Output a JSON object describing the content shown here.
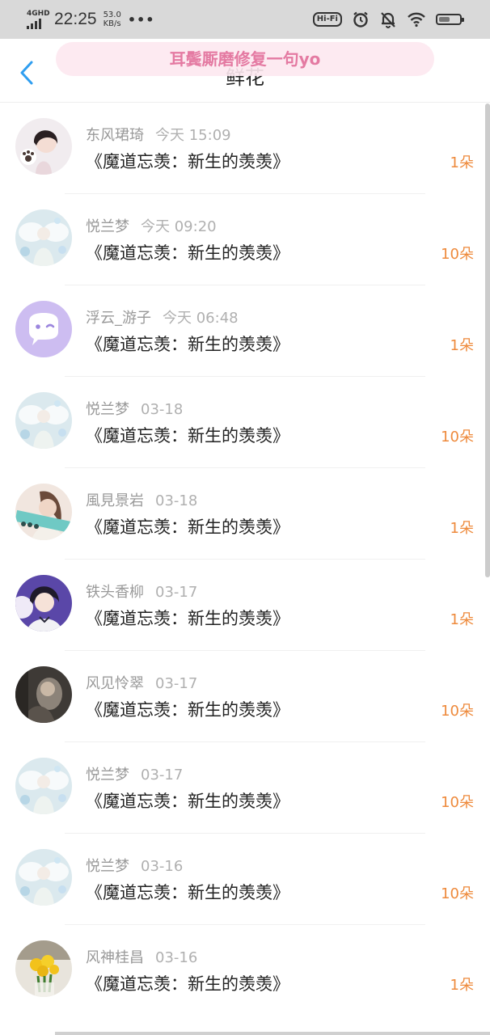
{
  "status_bar": {
    "network": "4GHD",
    "time": "22:25",
    "speed_value": "53.0",
    "speed_unit": "KB/s",
    "more": "•••",
    "hifi": "Hi-Fi"
  },
  "header": {
    "watermark": "耳鬓厮磨修复一句yo",
    "title": "鲜花"
  },
  "colors": {
    "count": "#ee8a3c",
    "back_arrow": "#2f9ef0",
    "watermark_text": "#e47aa2"
  },
  "items": [
    {
      "name": "东风珺琦",
      "time": "今天 15:09",
      "title": "《魔道忘羡：新生的羡羡》",
      "count": "1朵",
      "avatar": "girl-avatar"
    },
    {
      "name": "悦兰梦",
      "time": "今天 09:20",
      "title": "《魔道忘羡：新生的羡羡》",
      "count": "10朵",
      "avatar": "angel-avatar"
    },
    {
      "name": "浮云_游子",
      "time": "今天 06:48",
      "title": "《魔道忘羡：新生的羡羡》",
      "count": "1朵",
      "avatar": "default-avatar"
    },
    {
      "name": "悦兰梦",
      "time": "03-18",
      "title": "《魔道忘羡：新生的羡羡》",
      "count": "10朵",
      "avatar": "angel-avatar"
    },
    {
      "name": "風見景岩",
      "time": "03-18",
      "title": "《魔道忘羡：新生的羡羡》",
      "count": "1朵",
      "avatar": "girl-avatar"
    },
    {
      "name": "铁头香柳",
      "time": "03-17",
      "title": "《魔道忘羡：新生的羡羡》",
      "count": "1朵",
      "avatar": "girl-avatar"
    },
    {
      "name": "风见怜翠",
      "time": "03-17",
      "title": "《魔道忘羡：新生的羡羡》",
      "count": "10朵",
      "avatar": "photo-avatar"
    },
    {
      "name": "悦兰梦",
      "time": "03-17",
      "title": "《魔道忘羡：新生的羡羡》",
      "count": "10朵",
      "avatar": "angel-avatar"
    },
    {
      "name": "悦兰梦",
      "time": "03-16",
      "title": "《魔道忘羡：新生的羡羡》",
      "count": "10朵",
      "avatar": "angel-avatar"
    },
    {
      "name": "风神桂昌",
      "time": "03-16",
      "title": "《魔道忘羡：新生的羡羡》",
      "count": "1朵",
      "avatar": "flower-avatar"
    }
  ]
}
